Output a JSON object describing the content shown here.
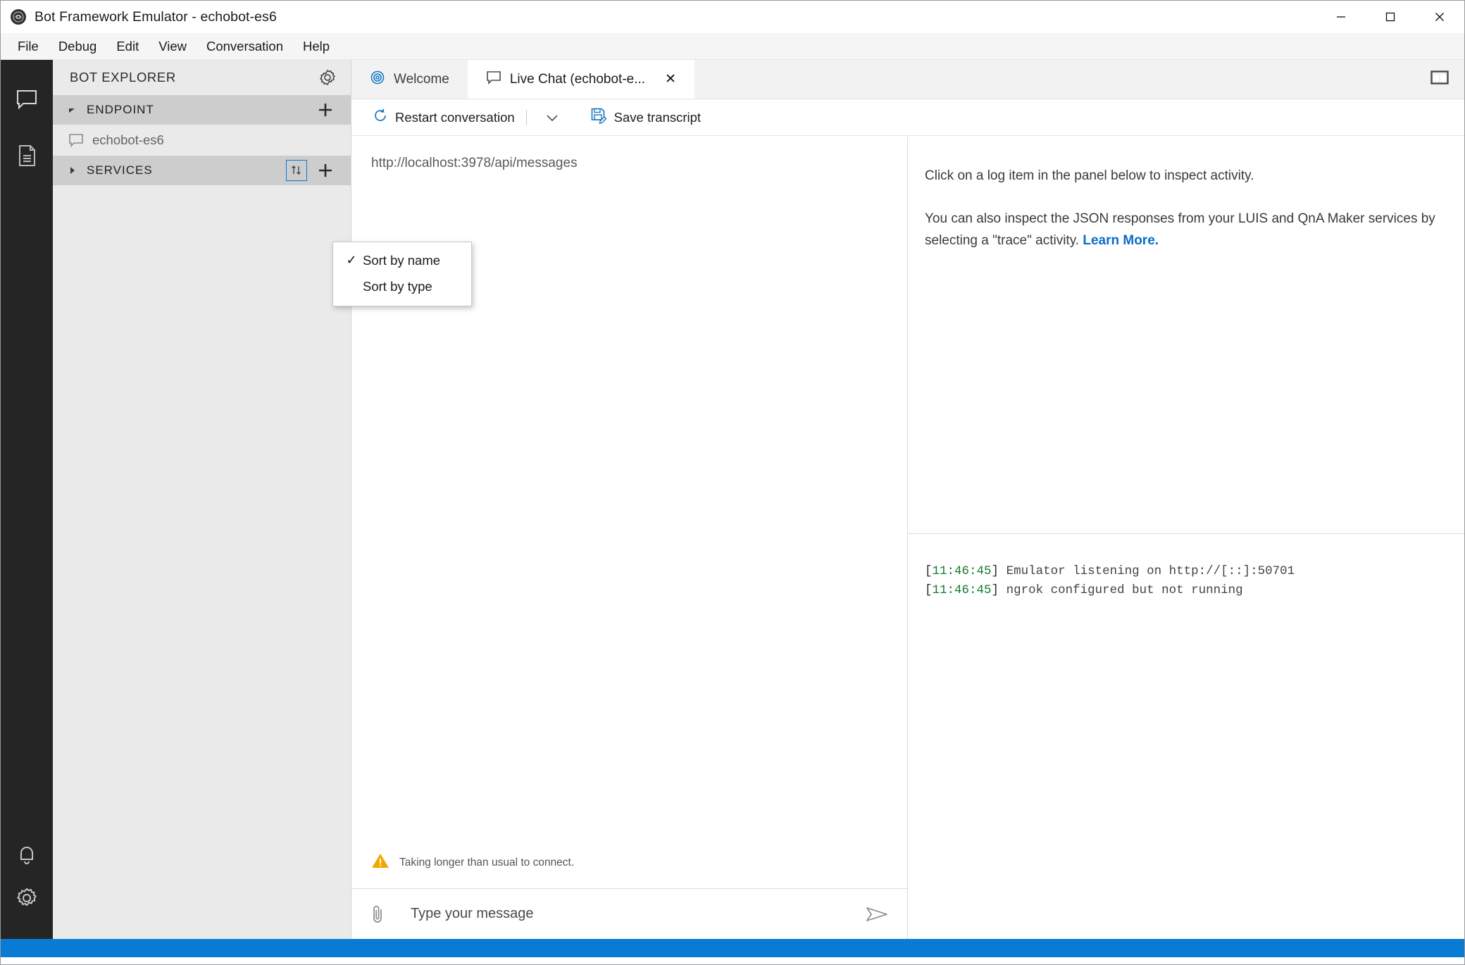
{
  "window": {
    "title": "Bot Framework Emulator - echobot-es6",
    "logo_icon": "bot-framework-logo-icon",
    "controls": [
      {
        "name": "minimize-button",
        "icon": "minimize-icon"
      },
      {
        "name": "maximize-button",
        "icon": "maximize-icon"
      },
      {
        "name": "close-button",
        "icon": "close-icon"
      }
    ]
  },
  "menubar": {
    "items": [
      {
        "label": "File"
      },
      {
        "label": "Debug"
      },
      {
        "label": "Edit"
      },
      {
        "label": "View"
      },
      {
        "label": "Conversation"
      },
      {
        "label": "Help"
      }
    ]
  },
  "activity_bar": {
    "items": [
      {
        "name": "chat-icon",
        "label": "Chat"
      },
      {
        "name": "transcript-icon",
        "label": "Transcript"
      },
      {
        "name": "notifications-bell-icon",
        "label": "Notifications"
      },
      {
        "name": "settings-gear-icon",
        "label": "Settings"
      }
    ]
  },
  "explorer": {
    "title": "BOT EXPLORER",
    "settings_icon": "gear-icon",
    "sections": [
      {
        "label": "ENDPOINT",
        "expanded": true,
        "twisty": "▲",
        "add_label": "+",
        "items": [
          {
            "label": "echobot-es6",
            "icon": "chat-bubble-icon"
          }
        ]
      },
      {
        "label": "SERVICES",
        "expanded": false,
        "twisty": "▶",
        "add_label": "+",
        "sort_icon": "sort-arrows-icon",
        "items": []
      }
    ]
  },
  "context_menu": {
    "items": [
      {
        "label": "Sort by name",
        "checked": true,
        "check_glyph": "✓"
      },
      {
        "label": "Sort by type",
        "checked": false,
        "check_glyph": ""
      }
    ]
  },
  "tabs": [
    {
      "label": "Welcome",
      "icon": "welcome-target-icon",
      "active": false,
      "closable": false
    },
    {
      "label": "Live Chat (echobot-e...",
      "icon": "chat-bubble-icon",
      "active": true,
      "closable": true,
      "close_glyph": "✕"
    }
  ],
  "tabbar": {
    "split_layout_icon": "split-panel-icon"
  },
  "toolbar": {
    "restart_label": "Restart conversation",
    "restart_icon": "restart-circle-icon",
    "restart_caret": "⌄",
    "save_label": "Save transcript",
    "save_icon": "save-disk-icon"
  },
  "chat": {
    "endpoint_url": "http://localhost:3978/api/messages",
    "warning_text": "Taking longer than usual to connect.",
    "warning_icon": "warning-triangle-icon",
    "attach_icon": "paperclip-icon",
    "input_placeholder": "Type your message",
    "input_value": "",
    "send_icon": "send-arrow-icon"
  },
  "inspector": {
    "paragraph_1": "Click on a log item in the panel below to inspect activity.",
    "paragraph_2_prefix": "You can also inspect the JSON responses from your LUIS and QnA Maker services by selecting a \"trace\" activity. ",
    "link_label": "Learn More."
  },
  "log": {
    "entries": [
      {
        "timestamp": "11:46:45",
        "message": "Emulator listening on http://[::]:50701"
      },
      {
        "timestamp": "11:46:45",
        "message": "ngrok configured but not running"
      }
    ]
  },
  "colors": {
    "accent": "#0a7bd4",
    "link": "#0a6cc9",
    "log_timestamp": "#157a2e",
    "warning": "#f2a800",
    "activity_bar_bg": "#252526",
    "explorer_bg": "#eaeaea",
    "section_header_bg": "#cdcdcd"
  }
}
